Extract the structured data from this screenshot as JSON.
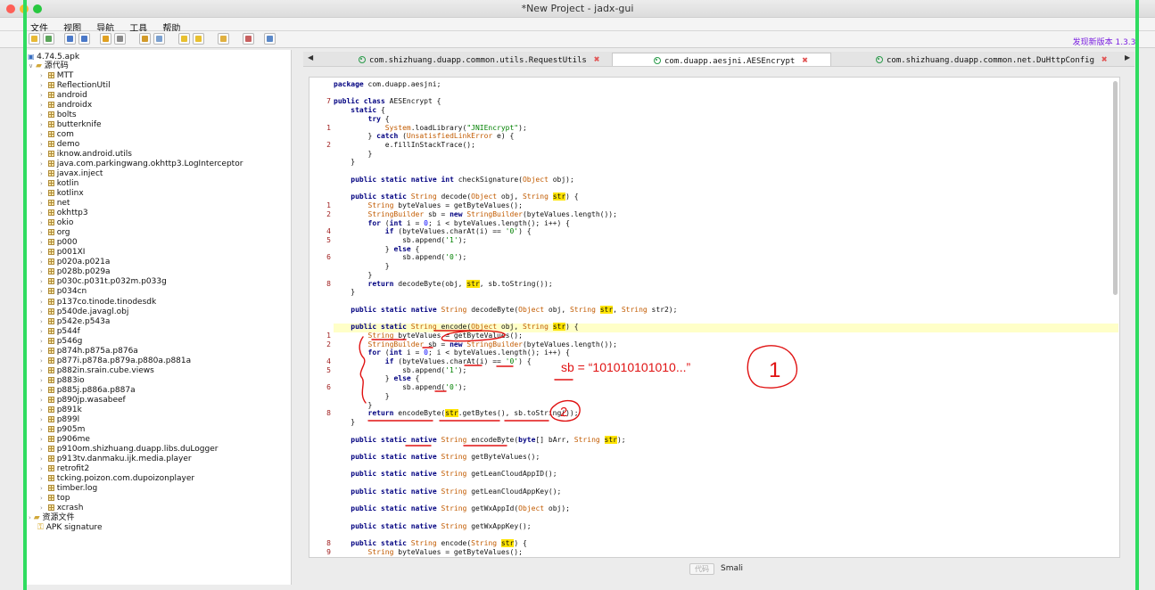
{
  "window": {
    "title": "*New Project - jadx-gui",
    "update_notice": "发现新版本 1.3.3!"
  },
  "menu": [
    "文件",
    "视图",
    "导航",
    "工具",
    "帮助"
  ],
  "tree": {
    "root": "4.74.5.apk",
    "source_folder": "源代码",
    "packages": [
      "MTT",
      "ReflectionUtil",
      "android",
      "androidx",
      "bolts",
      "butterknife",
      "com",
      "demo",
      "iknow.android.utils",
      "java.com.parkingwang.okhttp3.LogInterceptor",
      "javax.inject",
      "kotlin",
      "kotlinx",
      "net",
      "okhttp3",
      "okio",
      "org",
      "p000",
      "p001XI",
      "p020a.p021a",
      "p028b.p029a",
      "p030c.p031t.p032m.p033g",
      "p034cn",
      "p137co.tinode.tinodesdk",
      "p540de.javagl.obj",
      "p542e.p543a",
      "p544f",
      "p546g",
      "p874h.p875a.p876a",
      "p877i.p878a.p879a.p880a.p881a",
      "p882in.srain.cube.views",
      "p883io",
      "p885j.p886a.p887a",
      "p890jp.wasabeef",
      "p891k",
      "p899l",
      "p905m",
      "p906me",
      "p910om.shizhuang.duapp.libs.duLogger",
      "p913tv.danmaku.ijk.media.player",
      "retrofit2",
      "tcking.poizon.com.dupoizonplayer",
      "timber.log",
      "top",
      "xcrash"
    ],
    "resources": "资源文件",
    "signature": "APK signature"
  },
  "tabs": [
    {
      "label": "com.shizhuang.duapp.common.utils.RequestUtils"
    },
    {
      "label": "com.duapp.aesjni.AESEncrypt"
    },
    {
      "label": "com.shizhuang.duapp.common.net.DuHttpConfig"
    }
  ],
  "code": {
    "lines": [
      {
        "n": "",
        "t": "package com.duapp.aesjni;"
      },
      {
        "n": "",
        "t": ""
      },
      {
        "n": "7",
        "t": "public class AESEncrypt {"
      },
      {
        "n": "",
        "t": "    static {"
      },
      {
        "n": "",
        "t": "        try {"
      },
      {
        "n": "1",
        "t": "            System.loadLibrary(\"JNIEncrypt\");"
      },
      {
        "n": "",
        "t": "        } catch (UnsatisfiedLinkError e) {"
      },
      {
        "n": "2",
        "t": "            e.fillInStackTrace();"
      },
      {
        "n": "",
        "t": "        }"
      },
      {
        "n": "",
        "t": "    }"
      },
      {
        "n": "",
        "t": ""
      },
      {
        "n": "",
        "t": "    public static native int checkSignature(Object obj);"
      },
      {
        "n": "",
        "t": ""
      },
      {
        "n": "",
        "t": "    public static String decode(Object obj, String str) {"
      },
      {
        "n": "1",
        "t": "        String byteValues = getByteValues();"
      },
      {
        "n": "2",
        "t": "        StringBuilder sb = new StringBuilder(byteValues.length());"
      },
      {
        "n": "",
        "t": "        for (int i = 0; i < byteValues.length(); i++) {"
      },
      {
        "n": "4",
        "t": "            if (byteValues.charAt(i) == '0') {"
      },
      {
        "n": "5",
        "t": "                sb.append('1');"
      },
      {
        "n": "",
        "t": "            } else {"
      },
      {
        "n": "6",
        "t": "                sb.append('0');"
      },
      {
        "n": "",
        "t": "            }"
      },
      {
        "n": "",
        "t": "        }"
      },
      {
        "n": "8",
        "t": "        return decodeByte(obj, str, sb.toString());"
      },
      {
        "n": "",
        "t": "    }"
      },
      {
        "n": "",
        "t": ""
      },
      {
        "n": "",
        "t": "    public static native String decodeByte(Object obj, String str, String str2);"
      },
      {
        "n": "",
        "t": ""
      },
      {
        "n": "",
        "t": "    public static String encode(Object obj, String str) {"
      },
      {
        "n": "1",
        "t": "        String byteValues = getByteValues();"
      },
      {
        "n": "2",
        "t": "        StringBuilder sb = new StringBuilder(byteValues.length());"
      },
      {
        "n": "",
        "t": "        for (int i = 0; i < byteValues.length(); i++) {"
      },
      {
        "n": "4",
        "t": "            if (byteValues.charAt(i) == '0') {"
      },
      {
        "n": "5",
        "t": "                sb.append('1');"
      },
      {
        "n": "",
        "t": "            } else {"
      },
      {
        "n": "6",
        "t": "                sb.append('0');"
      },
      {
        "n": "",
        "t": "            }"
      },
      {
        "n": "",
        "t": "        }"
      },
      {
        "n": "8",
        "t": "        return encodeByte(str.getBytes(), sb.toString());"
      },
      {
        "n": "",
        "t": "    }"
      },
      {
        "n": "",
        "t": ""
      },
      {
        "n": "",
        "t": "    public static native String encodeByte(byte[] bArr, String str);"
      },
      {
        "n": "",
        "t": ""
      },
      {
        "n": "",
        "t": "    public static native String getByteValues();"
      },
      {
        "n": "",
        "t": ""
      },
      {
        "n": "",
        "t": "    public static native String getLeanCloudAppID();"
      },
      {
        "n": "",
        "t": ""
      },
      {
        "n": "",
        "t": "    public static native String getLeanCloudAppKey();"
      },
      {
        "n": "",
        "t": ""
      },
      {
        "n": "",
        "t": "    public static native String getWxAppId(Object obj);"
      },
      {
        "n": "",
        "t": ""
      },
      {
        "n": "",
        "t": "    public static native String getWxAppKey();"
      },
      {
        "n": "",
        "t": ""
      },
      {
        "n": "8",
        "t": "    public static String encode(String str) {"
      },
      {
        "n": "9",
        "t": "        String byteValues = getByteValues();"
      }
    ]
  },
  "annotation": {
    "text": "sb = “101010101010...”",
    "circle1": "1",
    "circle2": "2"
  },
  "bottom": {
    "button": "代码",
    "smali": "Smali"
  }
}
